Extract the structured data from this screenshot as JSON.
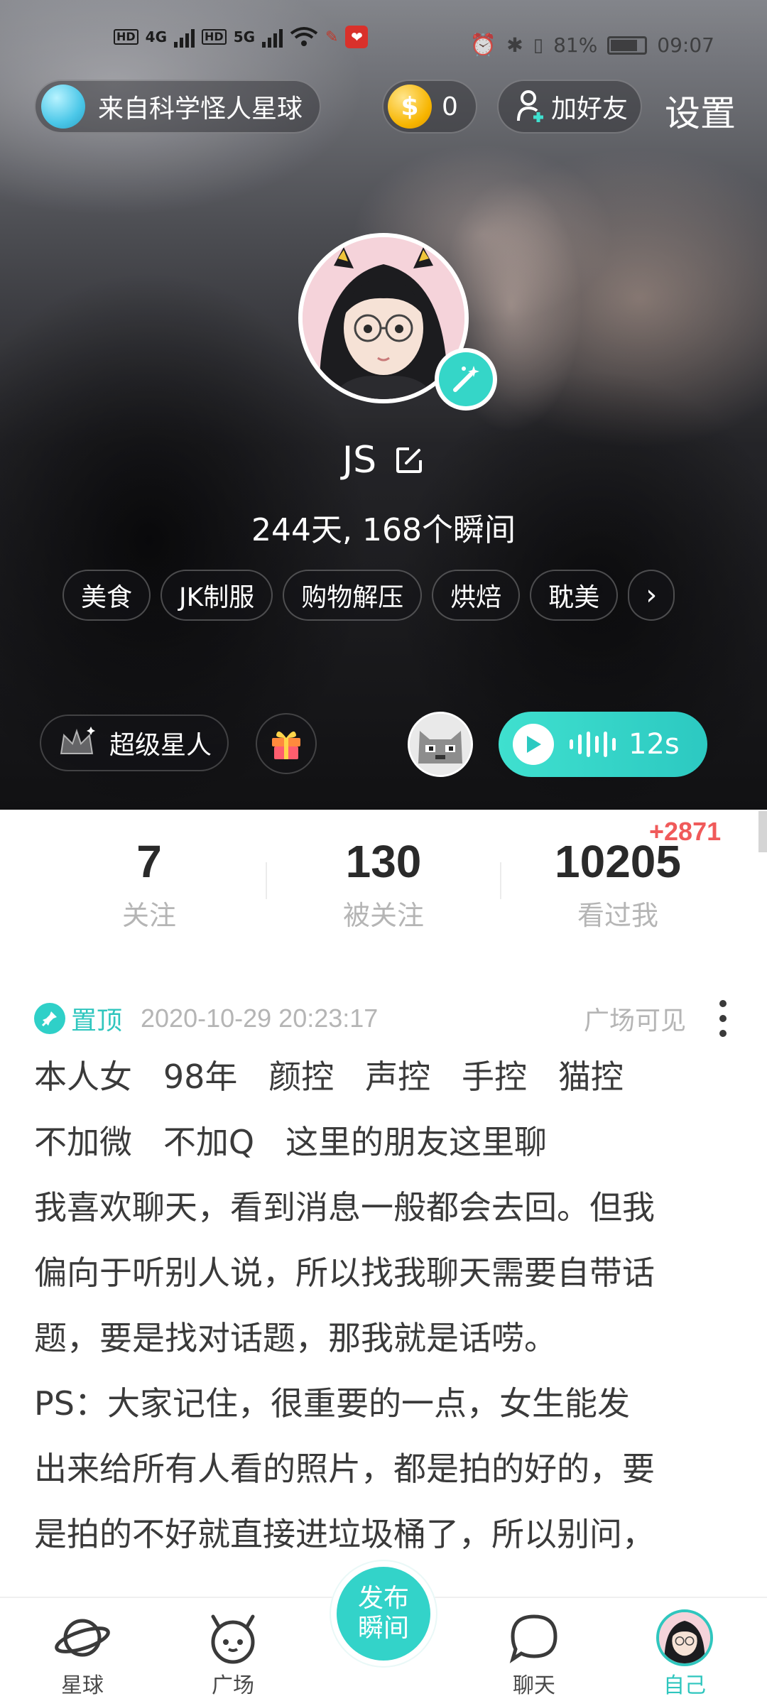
{
  "status_bar": {
    "hd1": "HD",
    "hd2": "HD",
    "net1": "4G",
    "net2": "5G",
    "battery": "81%",
    "battery_level": 0.81,
    "time": "09:07"
  },
  "header": {
    "planet_label": "来自科学怪人星球",
    "coins": "0",
    "add_friend_label": "加好友",
    "settings_label": "设置"
  },
  "profile": {
    "username": "JS",
    "stats_line": "244天, 168个瞬间",
    "tags": [
      "美食",
      "JK制服",
      "购物解压",
      "烘焙",
      "耽美"
    ],
    "vip_label": "超级星人",
    "voice_duration": "12s"
  },
  "counts": [
    {
      "value": "7",
      "label": "关注"
    },
    {
      "value": "130",
      "label": "被关注"
    },
    {
      "value": "10205",
      "label": "看过我"
    }
  ],
  "visitor_delta": "+2871",
  "post": {
    "pinned_label": "置顶",
    "date": "2020-10-29 20:23:17",
    "visibility": "广场可见",
    "lines": [
      "本人女   98年   颜控   声控   手控   猫控",
      "不加微   不加Q   这里的朋友这里聊",
      "我喜欢聊天，看到消息一般都会去回。但我",
      "偏向于听别人说，所以找我聊天需要自带话",
      "题，要是找对话题，那我就是话唠。",
      "PS：大家记住，很重要的一点，女生能发",
      "出来给所有人看的照片，都是拍的好的，要",
      "是拍的不好就直接进垃圾桶了，所以别问，"
    ]
  },
  "nav": {
    "planet": "星球",
    "square": "广场",
    "publish_line1": "发布",
    "publish_line2": "瞬间",
    "chat": "聊天",
    "me": "自己"
  },
  "colors": {
    "accent": "#2fc6be",
    "delta": "#f05a5a",
    "coin": "#f7b500"
  }
}
